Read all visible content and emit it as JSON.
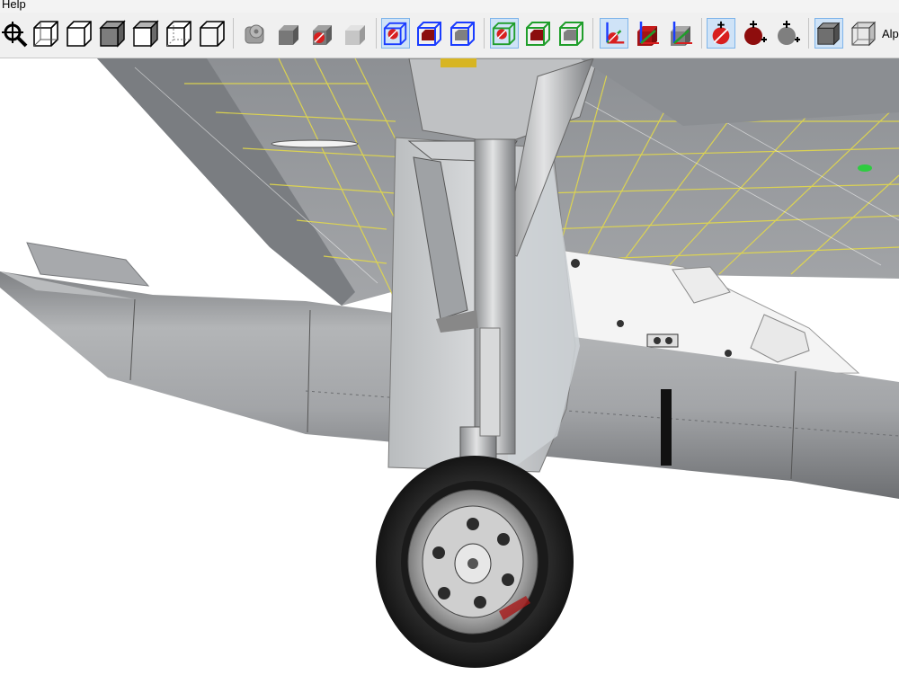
{
  "menu": {
    "help_label": "Help"
  },
  "toolbar": {
    "alpha_label": "Alp",
    "buttons": [
      {
        "name": "zoom-extents-icon",
        "selected": false
      },
      {
        "name": "wireframe-cube-icon",
        "selected": false
      },
      {
        "name": "wireframe-cube-2-icon",
        "selected": false
      },
      {
        "name": "shaded-cube-icon",
        "selected": false
      },
      {
        "name": "shaded-cube-2-icon",
        "selected": false
      },
      {
        "name": "wireframe-cube-3-icon",
        "selected": false
      },
      {
        "name": "wireframe-cube-4-icon",
        "selected": false
      },
      {
        "name": "gray-hub-icon",
        "selected": false
      },
      {
        "name": "solid-cube-icon",
        "selected": false
      },
      {
        "name": "red-marker-cube-icon",
        "selected": false
      },
      {
        "name": "light-cube-icon",
        "selected": false
      },
      {
        "name": "blue-box-marker-icon",
        "selected": true
      },
      {
        "name": "blue-box-red-icon",
        "selected": false
      },
      {
        "name": "blue-box-gray-icon",
        "selected": false
      },
      {
        "name": "green-box-marker-icon",
        "selected": true
      },
      {
        "name": "green-box-red-icon",
        "selected": false
      },
      {
        "name": "green-box-gray-icon",
        "selected": false
      },
      {
        "name": "axes-marker-icon",
        "selected": true
      },
      {
        "name": "axes-red-cube-icon",
        "selected": false
      },
      {
        "name": "axes-gray-cube-icon",
        "selected": false
      },
      {
        "name": "crosshair-marker-icon",
        "selected": true
      },
      {
        "name": "crosshair-red-sphere-icon",
        "selected": false
      },
      {
        "name": "crosshair-gray-sphere-icon",
        "selected": false
      },
      {
        "name": "solid-render-icon",
        "selected": true
      },
      {
        "name": "transparent-render-icon",
        "selected": false
      }
    ]
  },
  "colors": {
    "toolbar_bg": "#f0f0f0",
    "selected_bg": "#cfe3f7",
    "blue_accent": "#1a3cff",
    "green_accent": "#1f9e2a",
    "red_accent": "#c41a1a",
    "wire_yellow": "#e3d94a",
    "metal_gray": "#a3a5a8"
  },
  "viewport": {
    "content": "3d-model-view",
    "subject": "aircraft-main-landing-gear-with-drop-tank"
  }
}
